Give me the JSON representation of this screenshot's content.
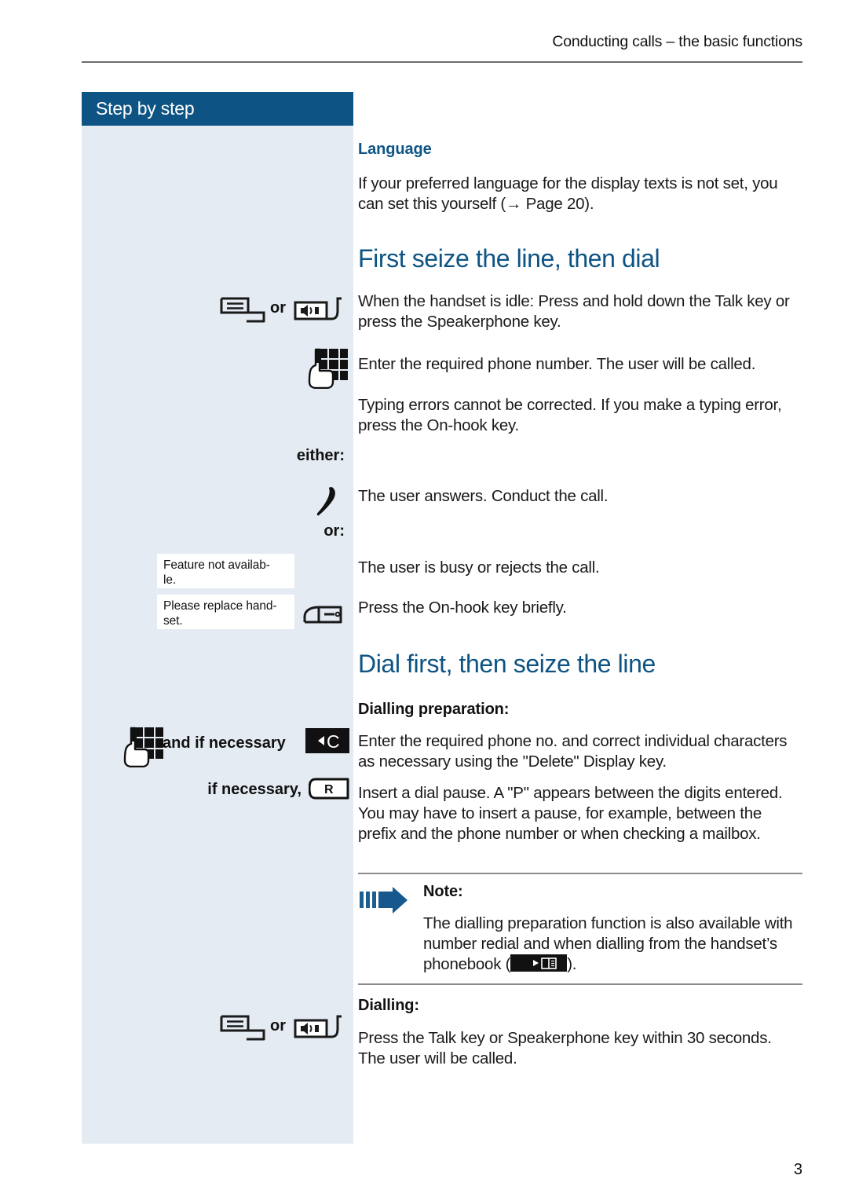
{
  "header": {
    "running_title": "Conducting calls – the basic functions"
  },
  "sidebar": {
    "title": "Step by step",
    "callouts": {
      "either": "either:",
      "or_colon": "or:",
      "or_word_1": "or",
      "or_word_2": "or",
      "and_if_necessary": "and if necessary",
      "if_necessary": "if necessary,"
    },
    "display_messages": [
      "Feature not availab-\nle.",
      "Please replace hand-\nset."
    ],
    "keys": {
      "talk_key": "talk-key",
      "speakerphone_key": "speakerphone-key",
      "keypad_key": "keypad-key",
      "handset_answer": "handset-answer-icon",
      "on_hook_key": "on-hook-key",
      "delete_key_label": "C",
      "r_key_label": "R"
    }
  },
  "main": {
    "language": {
      "heading": "Language",
      "paragraph": "If your preferred language for the display texts is not set, you can set this yourself (→ Page 20)."
    },
    "section_first_seize": {
      "heading": "First seize the line, then dial",
      "p1": "When the handset is idle: Press and hold down the Talk key or press the Speakerphone key.",
      "p2": "Enter the required phone number. The user will be called.",
      "p3": "Typing errors cannot be corrected. If you make a typing error, press the On-hook key.",
      "p4": "The user answers. Conduct the call.",
      "p5": "The user is busy or rejects the call.",
      "p6": "Press the On-hook key briefly."
    },
    "section_dial_first": {
      "heading": "Dial first, then seize the line",
      "sub_preparation": "Dialling preparation:",
      "p1": "Enter the required phone no. and correct individual characters as necessary using the \"Delete\" Display key.",
      "p2": "Insert a dial pause. A \"P\" appears between the digits entered. You may have to insert a pause, for example, between the prefix and the phone number or when checking a mailbox.",
      "note": {
        "label": "Note:",
        "text_before": "The dialling preparation function is also available with number redial and when dialling from the handset’s phonebook (",
        "text_after": ")."
      },
      "sub_dialling": "Dialling:",
      "p3": "Press the Talk key or Speakerphone key within 30 seconds. The user will be called."
    }
  },
  "footer": {
    "page_number": "3"
  },
  "colors": {
    "brand_blue": "#0d5484",
    "sidebar_bg": "#e4ebf2",
    "rule_gray": "#6d6d6d"
  }
}
